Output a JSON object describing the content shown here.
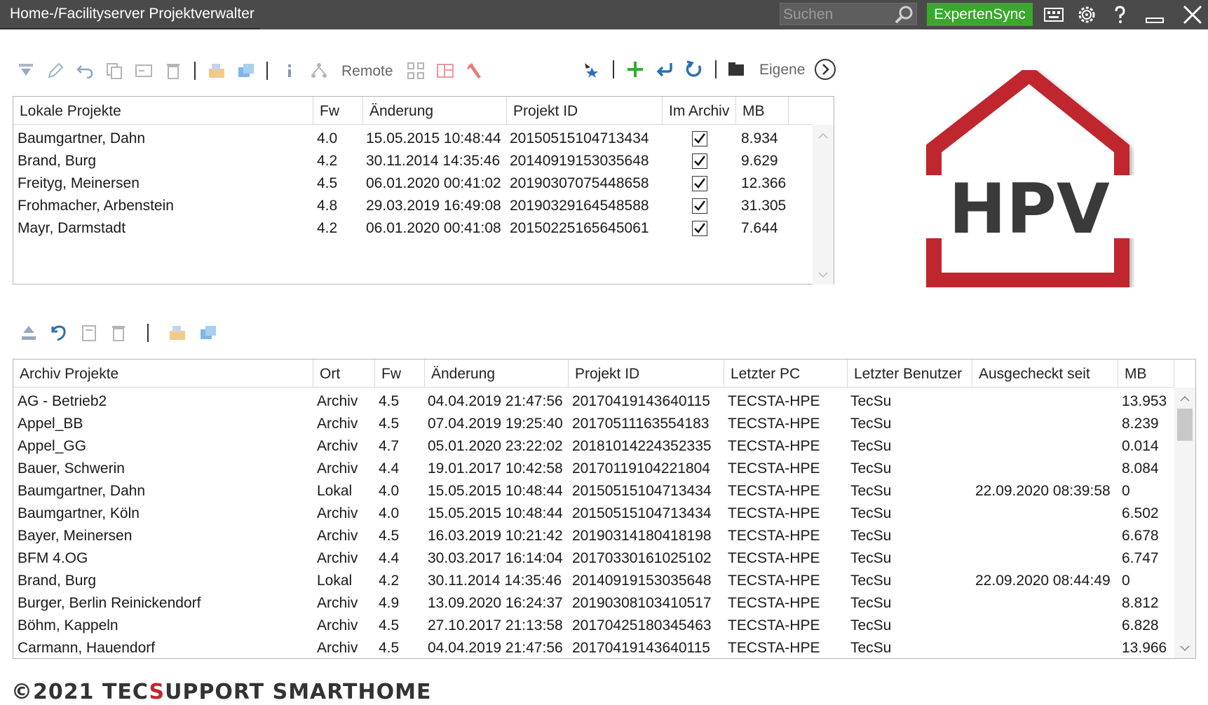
{
  "window": {
    "title": "Home-/Facilityserver Projektverwalter"
  },
  "titlebar": {
    "search_placeholder": "Suchen",
    "sync_button": "ExpertenSync",
    "sync_color": "#3aa82c"
  },
  "top_toolbar": {
    "remote_label": "Remote",
    "own_label": "Eigene"
  },
  "local_table": {
    "columns": [
      "Lokale Projekte",
      "Fw",
      "Änderung",
      "Projekt ID",
      "Im Archiv",
      "MB"
    ],
    "rows": [
      {
        "name": "Baumgartner, Dahn",
        "fw": "4.0",
        "date": "15.05.2015 10:48:44",
        "id": "20150515104713434",
        "archived": true,
        "mb": "8.934"
      },
      {
        "name": "Brand, Burg",
        "fw": "4.2",
        "date": "30.11.2014 14:35:46",
        "id": "20140919153035648",
        "archived": true,
        "mb": "9.629"
      },
      {
        "name": "Freityg, Meinersen",
        "fw": "4.5",
        "date": "06.01.2020 00:41:02",
        "id": "20190307075448658",
        "archived": true,
        "mb": "12.366"
      },
      {
        "name": "Frohmacher, Arbenstein",
        "fw": "4.8",
        "date": "29.03.2019 16:49:08",
        "id": "20190329164548588",
        "archived": true,
        "mb": "31.305"
      },
      {
        "name": "Mayr, Darmstadt",
        "fw": "4.2",
        "date": "06.01.2020 00:41:08",
        "id": "20150225165645061",
        "archived": true,
        "mb": "7.644"
      }
    ]
  },
  "archive_table": {
    "columns": [
      "Archiv Projekte",
      "Ort",
      "Fw",
      "Änderung",
      "Projekt ID",
      "Letzter PC",
      "Letzter Benutzer",
      "Ausgecheckt seit",
      "MB"
    ],
    "rows": [
      {
        "name": "AG - Betrieb2",
        "ort": "Archiv",
        "fw": "4.5",
        "date": "04.04.2019 21:47:56",
        "id": "20170419143640115",
        "pc": "TECSTA-HPE",
        "user": "TecSu",
        "checkout": "",
        "mb": "13.953"
      },
      {
        "name": "Appel_BB",
        "ort": "Archiv",
        "fw": "4.5",
        "date": "07.04.2019 19:25:40",
        "id": "20170511163554183",
        "pc": "TECSTA-HPE",
        "user": "TecSu",
        "checkout": "",
        "mb": "8.239"
      },
      {
        "name": "Appel_GG",
        "ort": "Archiv",
        "fw": "4.7",
        "date": "05.01.2020 23:22:02",
        "id": "20181014224352335",
        "pc": "TECSTA-HPE",
        "user": "TecSu",
        "checkout": "",
        "mb": "0.014"
      },
      {
        "name": "Bauer, Schwerin",
        "ort": "Archiv",
        "fw": "4.4",
        "date": "19.01.2017 10:42:58",
        "id": "20170119104221804",
        "pc": "TECSTA-HPE",
        "user": "TecSu",
        "checkout": "",
        "mb": "8.084"
      },
      {
        "name": "Baumgartner, Dahn",
        "ort": "Lokal",
        "fw": "4.0",
        "date": "15.05.2015 10:48:44",
        "id": "20150515104713434",
        "pc": "TECSTA-HPE",
        "user": "TecSu",
        "checkout": "22.09.2020 08:39:58",
        "mb": "0"
      },
      {
        "name": "Baumgartner, Köln",
        "ort": "Archiv",
        "fw": "4.0",
        "date": "15.05.2015 10:48:44",
        "id": "20150515104713434",
        "pc": "TECSTA-HPE",
        "user": "TecSu",
        "checkout": "",
        "mb": "6.502"
      },
      {
        "name": "Bayer, Meinersen",
        "ort": "Archiv",
        "fw": "4.5",
        "date": "16.03.2019 10:21:42",
        "id": "20190314180418198",
        "pc": "TECSTA-HPE",
        "user": "TecSu",
        "checkout": "",
        "mb": "6.678"
      },
      {
        "name": "BFM 4.OG",
        "ort": "Archiv",
        "fw": "4.4",
        "date": "30.03.2017 16:14:04",
        "id": "20170330161025102",
        "pc": "TECSTA-HPE",
        "user": "TecSu",
        "checkout": "",
        "mb": "6.747"
      },
      {
        "name": "Brand, Burg",
        "ort": "Lokal",
        "fw": "4.2",
        "date": "30.11.2014 14:35:46",
        "id": "20140919153035648",
        "pc": "TECSTA-HPE",
        "user": "TecSu",
        "checkout": "22.09.2020 08:44:49",
        "mb": "0"
      },
      {
        "name": "Burger, Berlin Reinickendorf",
        "ort": "Archiv",
        "fw": "4.9",
        "date": "13.09.2020 16:24:37",
        "id": "20190308103410517",
        "pc": "TECSTA-HPE",
        "user": "TecSu",
        "checkout": "",
        "mb": "8.812"
      },
      {
        "name": "Böhm, Kappeln",
        "ort": "Archiv",
        "fw": "4.5",
        "date": "27.10.2017 21:13:58",
        "id": "20170425180345463",
        "pc": "TECSTA-HPE",
        "user": "TecSu",
        "checkout": "",
        "mb": "6.828"
      },
      {
        "name": "Carmann, Hauendorf",
        "ort": "Archiv",
        "fw": "4.5",
        "date": "04.04.2019 21:47:56",
        "id": "20170419143640115",
        "pc": "TECSTA-HPE",
        "user": "TecSu",
        "checkout": "",
        "mb": "13.966"
      }
    ]
  },
  "logo": {
    "text": "HPV",
    "frame_color": "#c0282d",
    "text_color": "#3a3a3a"
  },
  "footer": {
    "prefix": "©2021 TEC",
    "red_letter": "S",
    "suffix": "UPPORT SMARTHOME"
  }
}
